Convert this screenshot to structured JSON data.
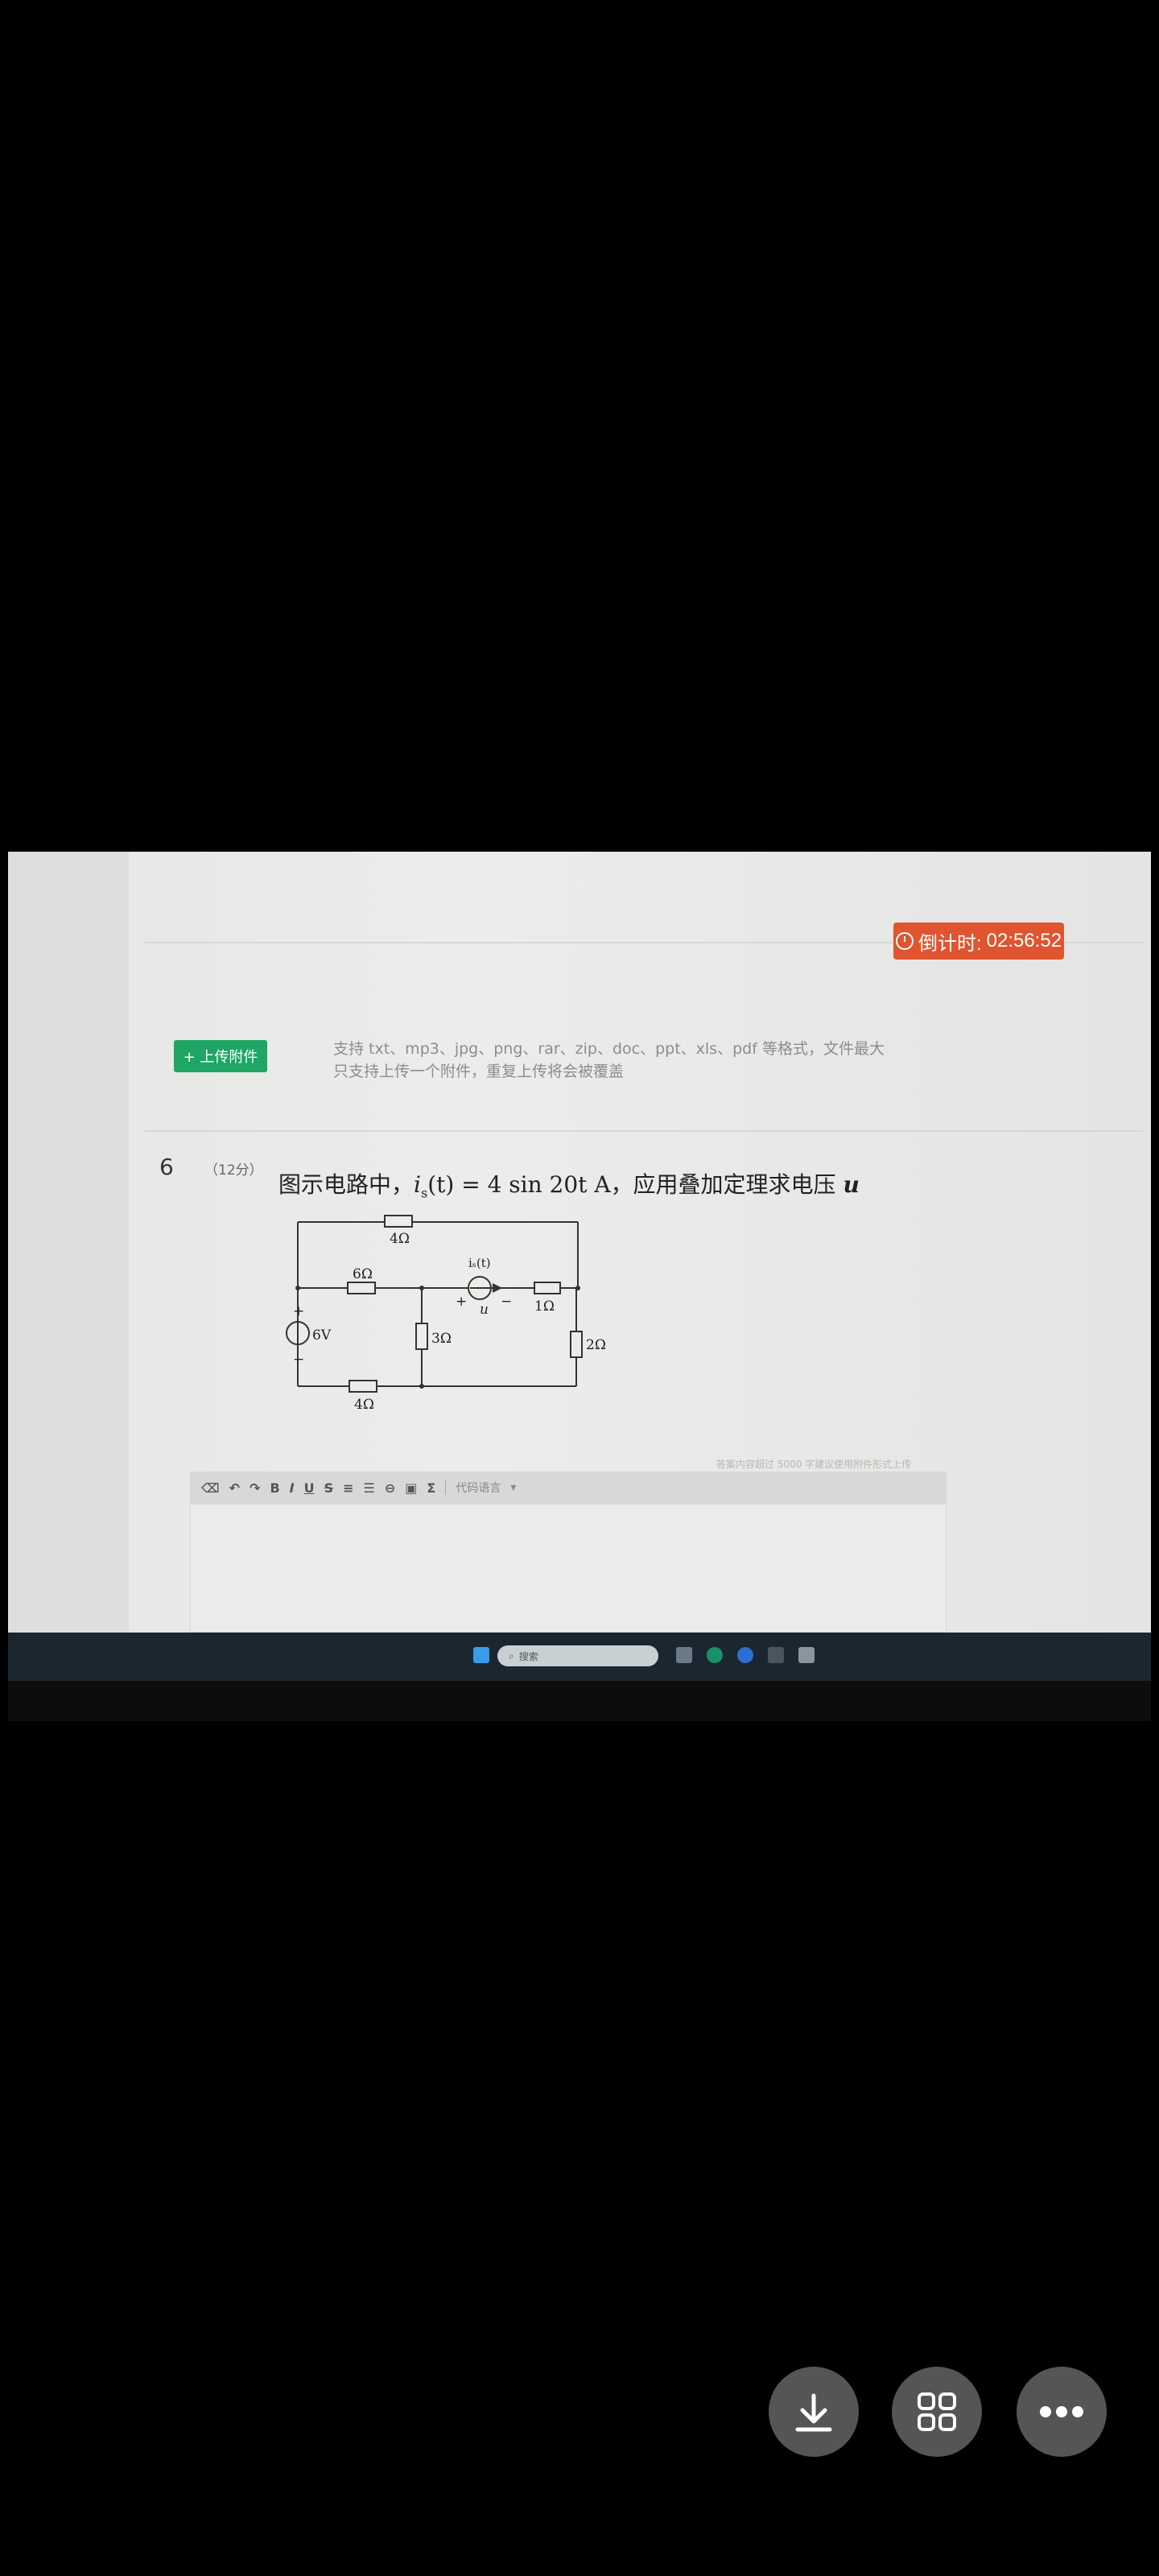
{
  "timer": {
    "label": "倒计时:",
    "value": "02:56:52"
  },
  "upload": {
    "button_label": "+ 上传附件"
  },
  "hints": {
    "line1": "支持 txt、mp3、jpg、png、rar、zip、doc、ppt、xls、pdf 等格式，文件最大",
    "line2": "只支持上传一个附件，重复上传将会被覆盖"
  },
  "question": {
    "number": "6",
    "score": "（12分）",
    "text_prefix": "图示电路中，",
    "formula": "i",
    "formula_sub": "s",
    "formula_rest": "(t) = 4 sin 20t A",
    "text_suffix": "，应用叠加定理求电压 ",
    "var": "u"
  },
  "circuit": {
    "r_top": "4Ω",
    "r_6": "6Ω",
    "r_3": "3Ω",
    "r_1": "1Ω",
    "r_2": "2Ω",
    "r_bottom": "4Ω",
    "source_v": "6V",
    "source_i": "iₛ(t)",
    "u_label": "u",
    "plus": "+",
    "minus": "−"
  },
  "editor": {
    "note": "答案内容超过 5000 字建议使用附件形式上传",
    "code_lang": "代码语言",
    "tools": [
      "B",
      "I",
      "U",
      "S",
      "Σ"
    ]
  },
  "taskbar": {
    "search_label": "搜索"
  }
}
